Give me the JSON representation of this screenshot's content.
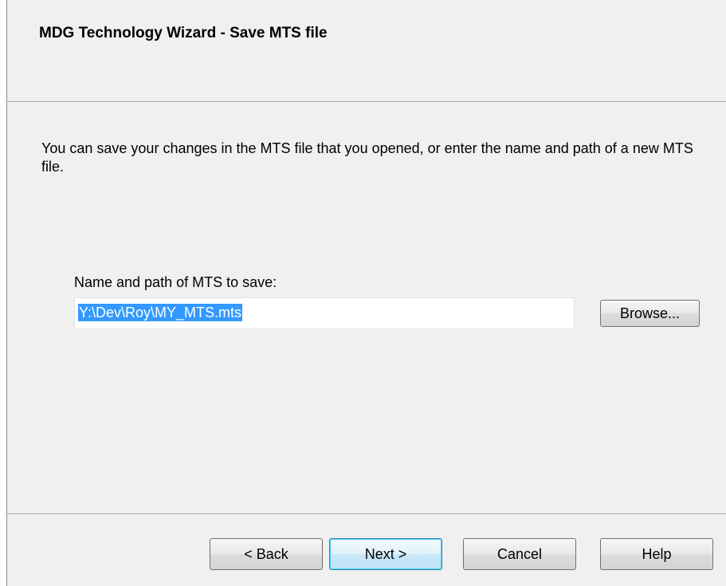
{
  "header": {
    "title": "MDG Technology Wizard - Save MTS file"
  },
  "main": {
    "description": "You can save your changes in the MTS file that you opened, or enter the name and path of a new MTS file.",
    "field_label": "Name and path of MTS to save:",
    "path_value": "Y:\\Dev\\Roy\\MY_MTS.mts",
    "browse_label": "Browse..."
  },
  "footer": {
    "back_label": "< Back",
    "next_label": "Next >",
    "cancel_label": "Cancel",
    "help_label": "Help"
  },
  "colors": {
    "dialog_background": "#f0f0f0",
    "selection_highlight": "#3399ff",
    "default_button_border": "#3c7fb1"
  }
}
